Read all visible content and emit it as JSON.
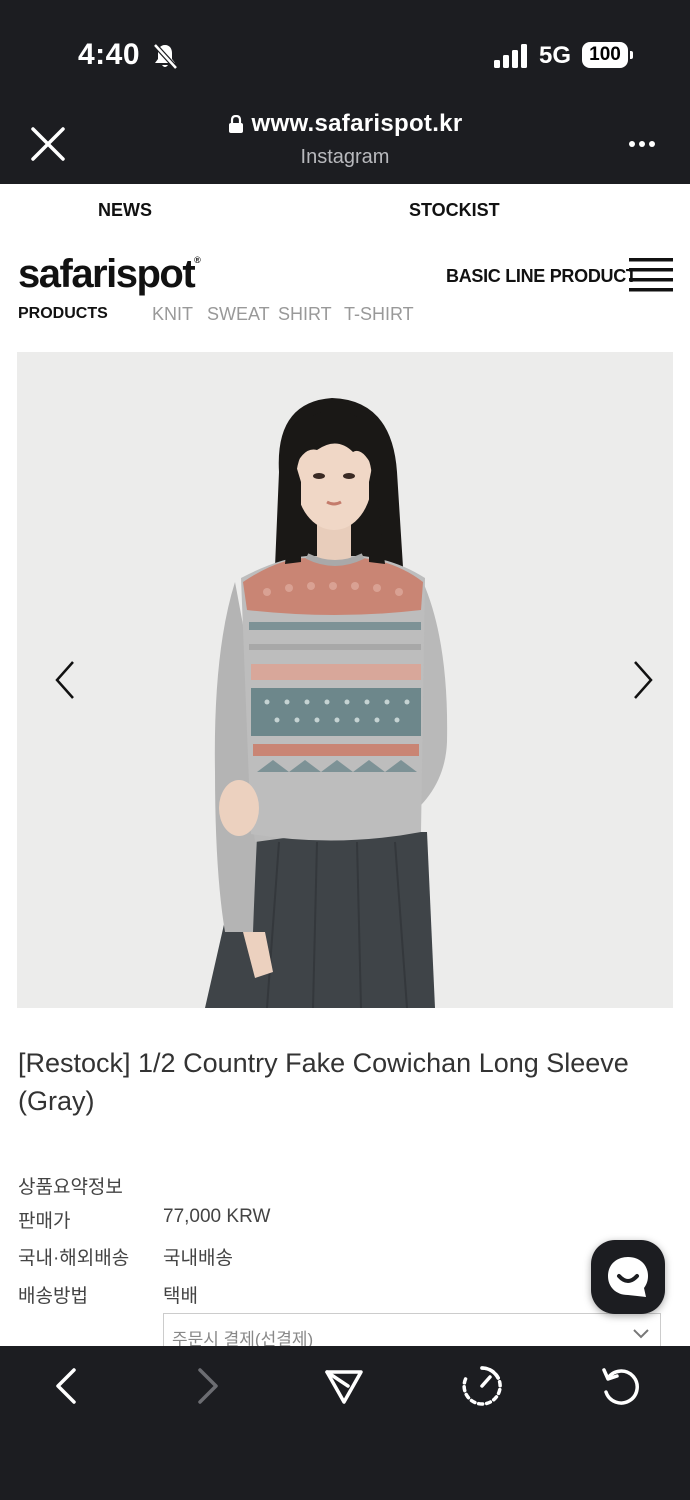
{
  "status_bar": {
    "time": "4:40",
    "network": "5G",
    "battery": "100"
  },
  "browser": {
    "url": "www.safarispot.kr",
    "subtitle": "Instagram"
  },
  "top_nav": {
    "items": [
      "NEWS",
      "STOCKIST"
    ]
  },
  "header": {
    "logo": "safarispot",
    "logo_mark": "®",
    "basic_line": "BASIC LINE PRODUCT",
    "products_label": "PRODUCTS",
    "categories": [
      "KNIT",
      "SWEAT",
      "SHIRT",
      "T-SHIRT"
    ]
  },
  "product": {
    "title": "[Restock] 1/2 Country Fake Cowichan Long Sleeve (Gray)",
    "info": [
      {
        "label": "상품요약정보",
        "value": ""
      },
      {
        "label": "판매가",
        "value": "77,000 KRW"
      },
      {
        "label": "국내·해외배송",
        "value": "국내배송"
      },
      {
        "label": "배송방법",
        "value": "택배"
      }
    ],
    "option_placeholder": "주문시 결제(선결제)"
  },
  "colors": {
    "dark_chrome": "#1c1d21",
    "page_bg": "#ffffff",
    "muted_text": "#999999",
    "image_bg": "#ececeb"
  },
  "icons": [
    "bell-slash-icon",
    "signal-icon",
    "lock-icon",
    "close-icon",
    "more-icon",
    "menu-icon",
    "arrow-left-icon",
    "arrow-right-icon",
    "chevron-down-icon",
    "chat-icon",
    "back-icon",
    "forward-icon",
    "share-icon",
    "speed-icon",
    "reload-icon"
  ]
}
